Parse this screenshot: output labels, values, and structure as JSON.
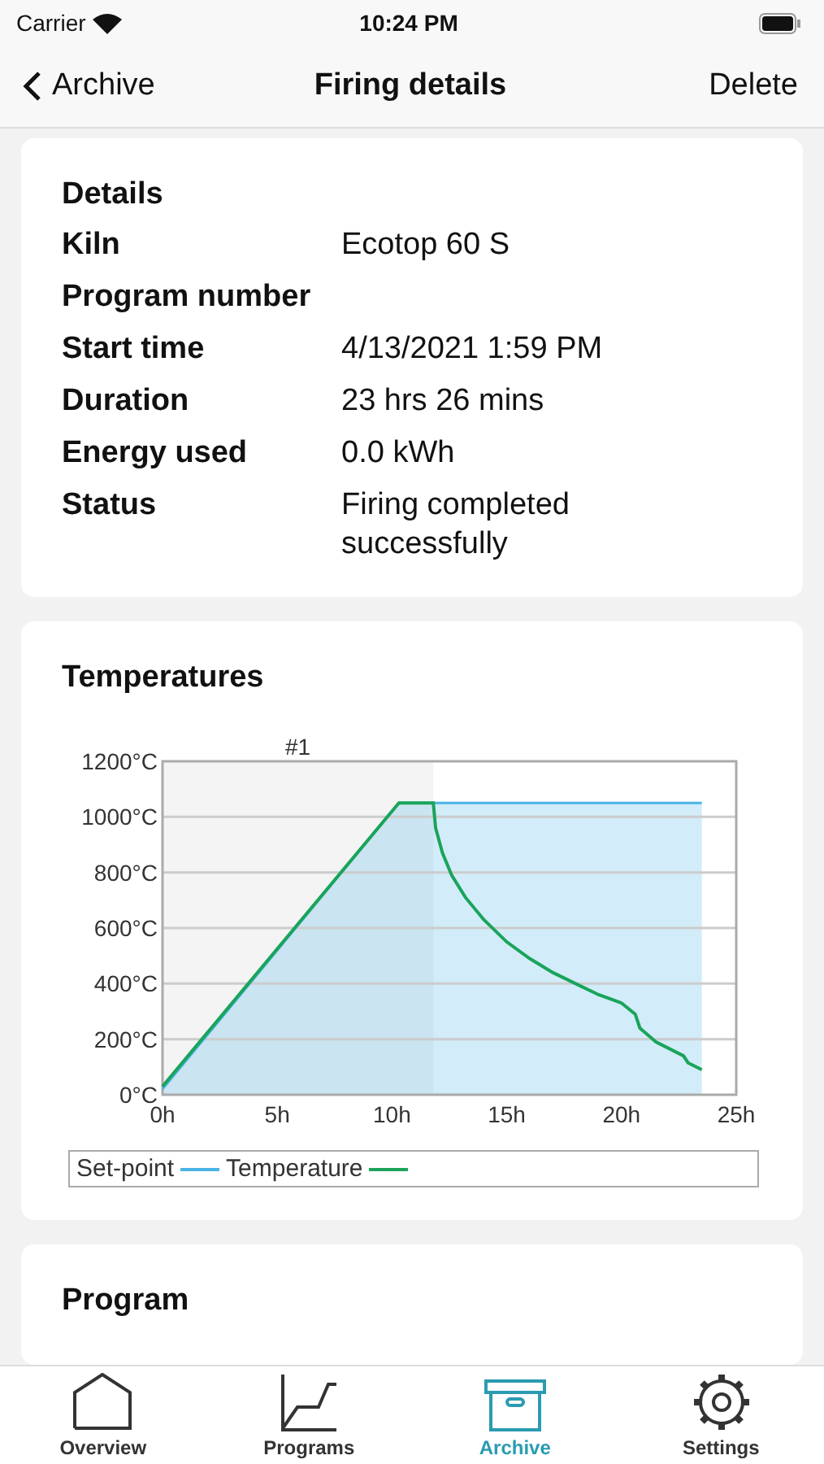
{
  "status_bar": {
    "carrier": "Carrier",
    "time": "10:24 PM"
  },
  "nav": {
    "back": "Archive",
    "title": "Firing details",
    "action": "Delete"
  },
  "details": {
    "title": "Details",
    "rows": [
      {
        "label": "Kiln",
        "value": "Ecotop 60 S"
      },
      {
        "label": "Program number",
        "value": ""
      },
      {
        "label": "Start time",
        "value": "4/13/2021 1:59 PM"
      },
      {
        "label": "Duration",
        "value": "23 hrs 26 mins"
      },
      {
        "label": "Energy used",
        "value": "0.0 kWh"
      },
      {
        "label": "Status",
        "value": "Firing completed successfully"
      }
    ]
  },
  "temperatures": {
    "title": "Temperatures",
    "chart_data": {
      "type": "line",
      "grid": true,
      "x": [
        0,
        10.3,
        11.8,
        11.9,
        12.2,
        12.6,
        13.2,
        14,
        15,
        16,
        17,
        18,
        19,
        20,
        20.6,
        20.8,
        21.5,
        22.7,
        22.9,
        23.5
      ],
      "series": [
        {
          "name": "Set-point",
          "type": "area",
          "color": "#4ab4e6",
          "values": [
            20,
            1050,
            1050,
            1050,
            1050,
            1050,
            1050,
            1050,
            1050,
            1050,
            1050,
            1050,
            1050,
            1050,
            1050,
            1050,
            1050,
            1050,
            1050,
            1050
          ]
        },
        {
          "name": "Temperature",
          "type": "line",
          "color": "#1aa45a",
          "values": [
            30,
            1050,
            1050,
            960,
            870,
            790,
            710,
            630,
            550,
            490,
            440,
            400,
            360,
            330,
            290,
            240,
            190,
            140,
            115,
            90
          ]
        }
      ],
      "xlim": [
        0,
        25
      ],
      "ylim": [
        0,
        1200
      ],
      "xticks": [
        {
          "value": 0,
          "label": "0h"
        },
        {
          "value": 5,
          "label": "5h"
        },
        {
          "value": 10,
          "label": "10h"
        },
        {
          "value": 15,
          "label": "15h"
        },
        {
          "value": 20,
          "label": "20h"
        },
        {
          "value": 25,
          "label": "25h"
        }
      ],
      "yticks": [
        {
          "value": 0,
          "label": "0°C"
        },
        {
          "value": 200,
          "label": "200°C"
        },
        {
          "value": 400,
          "label": "400°C"
        },
        {
          "value": 600,
          "label": "600°C"
        },
        {
          "value": 800,
          "label": "800°C"
        },
        {
          "value": 1000,
          "label": "1000°C"
        },
        {
          "value": 1200,
          "label": "1200°C"
        }
      ],
      "annotations": [
        {
          "text": "#1"
        }
      ]
    }
  },
  "program": {
    "title": "Program"
  },
  "tabs": [
    {
      "label": "Overview",
      "kind": "home",
      "selected": false
    },
    {
      "label": "Programs",
      "kind": "curve",
      "selected": false
    },
    {
      "label": "Archive",
      "kind": "box",
      "selected": true
    },
    {
      "label": "Settings",
      "kind": "gear",
      "selected": false
    }
  ]
}
